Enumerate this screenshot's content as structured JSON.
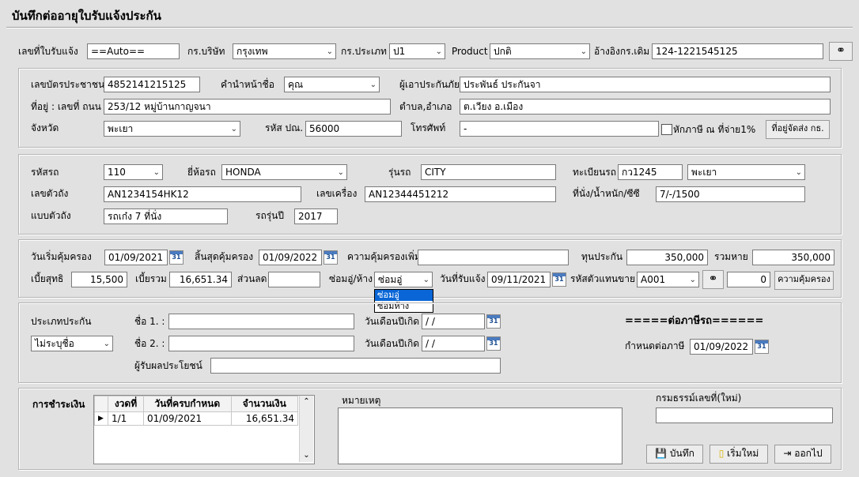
{
  "page_title": "บันทึกต่ออายุใบรับแจ้งประกัน",
  "row1": {
    "notice_no_label": "เลขที่ใบรับแจ้ง",
    "notice_no_value": "==Auto==",
    "company_label": "กร.บริษัท",
    "company_value": "กรุงเทพ",
    "type_label": "กร.ประเภท",
    "type_value": "ป1",
    "product_label": "Product",
    "product_value": "ปกติ",
    "ref_label": "อ้างอิงกร.เดิม",
    "ref_value": "124-1221545125"
  },
  "customer": {
    "id_label": "เลขบัตรประชาชน",
    "id_value": "4852141215125",
    "prefix_label": "คำนำหน้าชื่อ",
    "prefix_value": "คุณ",
    "insured_label": "ผู้เอาประกันภัย",
    "insured_value": "ประพันธ์ ประกันจา",
    "address_label": "ที่อยู่ : เลขที่ ถนน",
    "address_value": "253/12 หมู่บ้านกาญจนา",
    "district_label": "ตำบล,อำเภอ",
    "district_value": "ต.เวียง อ.เมือง",
    "province_label": "จังหวัด",
    "province_value": "พะเยา",
    "postcode_label": "รหัส ปณ.",
    "postcode_value": "56000",
    "phone_label": "โทรศัพท์",
    "phone_value": "-",
    "tax_check_label": "หักภาษี ณ ที่จ่าย1%",
    "ship_address_button": "ที่อยู่จัดส่ง กธ."
  },
  "vehicle": {
    "code_label": "รหัสรถ",
    "code_value": "110",
    "brand_label": "ยี่ห้อรถ",
    "brand_value": "HONDA",
    "model_label": "รุ่นรถ",
    "model_value": "CITY",
    "plate_label": "ทะเบียนรถ",
    "plate_value": "กว1245",
    "plate_province_value": "พะเยา",
    "chassis_label": "เลขตัวถัง",
    "chassis_value": "AN1234154HK12",
    "engine_label": "เลขเครื่อง",
    "engine_value": "AN12344451212",
    "seat_label": "ที่นั่ง/น้ำหนัก/ซีซี",
    "seat_value": "7/-/1500",
    "body_label": "แบบตัวถัง",
    "body_value": "รถเก๋ง 7 ที่นั่ง",
    "year_label": "รถรุ่นปี",
    "year_value": "2017"
  },
  "coverage": {
    "start_label": "วันเริ่มคุ้มครอง",
    "start_value": "01/09/2021",
    "end_label": "สิ้นสุดคุ้มครอง",
    "end_value": "01/09/2022",
    "extra_label": "ความคุ้มครองเพิ่ม",
    "extra_value": "",
    "sum_label": "ทุนประกัน",
    "sum_value": "350,000",
    "total_loss_label": "รวมหาย",
    "total_loss_value": "350,000",
    "net_label": "เบี้ยสุทธิ",
    "net_value": "15,500",
    "gross_label": "เบี้ยรวม",
    "gross_value": "16,651.34",
    "discount_label": "ส่วนลด",
    "discount_value": "",
    "repair_label": "ซ่อมอู่/ห้าง",
    "repair_value": "ซ่อมอู่",
    "repair_options": [
      "ซ่อมอู่",
      "ซ่อมห้าง"
    ],
    "receive_label": "วันที่รับแจ้ง",
    "receive_value": "09/11/2021",
    "agent_label": "รหัสตัวแทนขาย",
    "agent_value": "A001",
    "agent_num_value": "0",
    "coverage_button": "ความคุ้มครอง"
  },
  "beneficiary": {
    "type_label": "ประเภทประกัน",
    "type_value": "ไม่ระบุชื่อ",
    "name1_label": "ชื่อ 1. :",
    "name1_value": "",
    "name2_label": "ชื่อ 2. :",
    "name2_value": "",
    "dob_label": "วันเดือนปีเกิด",
    "dob1_value": " /  /",
    "dob2_value": " /  /",
    "benefit_label": "ผู้รับผลประโยชน์",
    "benefit_value": "",
    "tax_title": "=====ต่อภาษีรถ======",
    "tax_due_label": "กำหนดต่อภาษี",
    "tax_due_value": "01/09/2022"
  },
  "payment": {
    "label": "การชำระเงิน",
    "columns": [
      "งวดที่",
      "วันที่ครบกำหนด",
      "จำนวนเงิน"
    ],
    "rows": [
      {
        "installment": "1/1",
        "due": "01/09/2021",
        "amount": "16,651.34"
      }
    ],
    "remark_label": "หมายเหตุ",
    "remark_value": "",
    "policy_label": "กรมธรรม์เลขที่(ใหม่)",
    "policy_value": "",
    "save_button": "บันทึก",
    "new_button": "เริ่มใหม่",
    "exit_button": "ออกไป"
  },
  "icons": {
    "calendar": "calendar-icon",
    "binocular": "binocular-icon",
    "dropdown": "chevron-down-icon"
  }
}
